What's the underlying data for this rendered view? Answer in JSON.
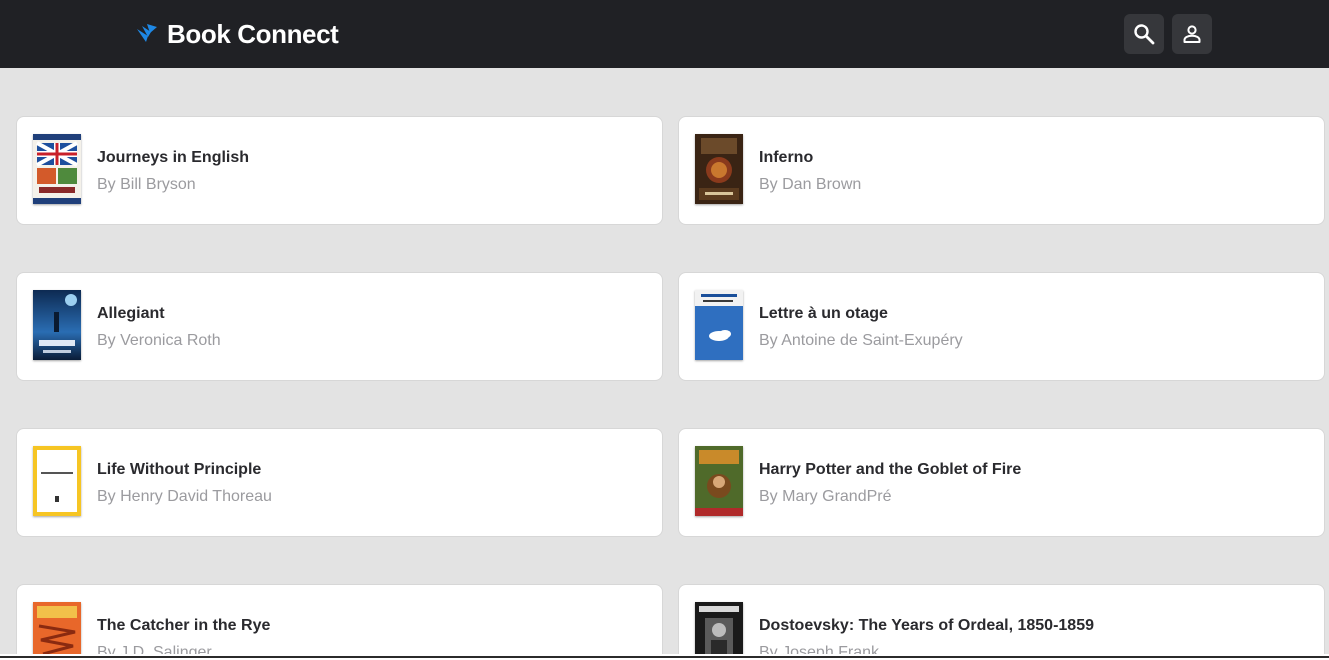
{
  "app": {
    "name": "Book Connect",
    "brand_color": "#1e88e5",
    "header_bg": "#202125"
  },
  "header": {
    "logo_icon": "bird-icon",
    "search_icon": "search-icon",
    "profile_icon": "person-icon"
  },
  "books": [
    {
      "title": "Journeys in English",
      "author": "By Bill Bryson"
    },
    {
      "title": "Inferno",
      "author": "By Dan Brown"
    },
    {
      "title": "Allegiant",
      "author": "By Veronica Roth"
    },
    {
      "title": "Lettre à un otage",
      "author": "By Antoine de Saint-Exupéry"
    },
    {
      "title": "Life Without Principle",
      "author": "By Henry David Thoreau"
    },
    {
      "title": "Harry Potter and the Goblet of Fire",
      "author": "By Mary GrandPré"
    },
    {
      "title": "The Catcher in the Rye",
      "author": "By J.D. Salinger"
    },
    {
      "title": "Dostoevsky: The Years of Ordeal, 1850-1859",
      "author": "By Joseph Frank"
    }
  ]
}
